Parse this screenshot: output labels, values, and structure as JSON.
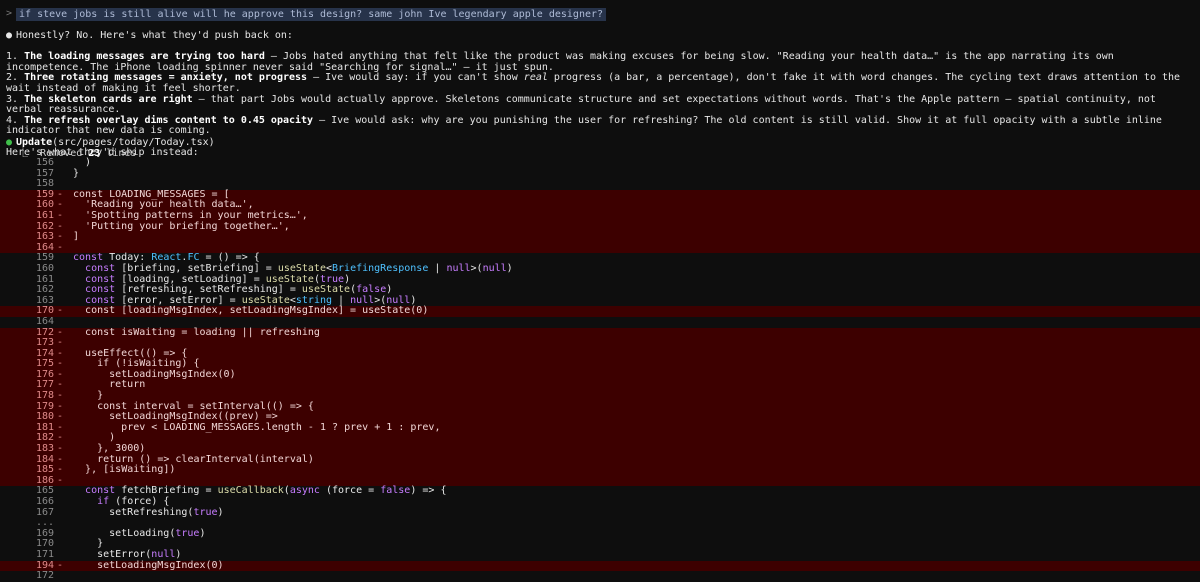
{
  "prompt": {
    "caret": ">",
    "text": "if steve jobs is still alive will he approve this design? same john Ive legendary apple designer?"
  },
  "response": {
    "intro": "Honestly? No. Here's what they'd push back on:",
    "items": [
      {
        "num": "1.",
        "title": "The loading messages are trying too hard",
        "body": " — Jobs hated anything that felt like the product was making excuses for being slow. \"Reading your health data…\" is the app narrating its own incompetence. The iPhone loading spinner never said \"Searching for signal…\" — it just spun."
      },
      {
        "num": "2.",
        "title": "Three rotating messages = anxiety, not progress",
        "body": " — Ive would say: if you can't show ",
        "em": "real",
        "body2": " progress (a bar, a percentage), don't fake it with word changes. The cycling text draws attention to the wait instead of making it feel shorter."
      },
      {
        "num": "3.",
        "title": "The skeleton cards are right",
        "body": " — that part Jobs would actually approve. Skeletons communicate structure and set expectations without words. That's the Apple pattern — spatial continuity, not verbal reassurance."
      },
      {
        "num": "4.",
        "title": "The refresh overlay dims content to 0.45 opacity",
        "body": " — Ive would ask: why are you punishing the user for refreshing? The old content is still valid. Show it at full opacity with a subtle inline indicator that new data is coming."
      }
    ],
    "outro": "Here's what they'd ship instead:"
  },
  "tool": {
    "name": "Update",
    "path": "(src/pages/today/Today.tsx)",
    "sub_prefix": "⎿  Removed ",
    "removed": "23",
    "sub_suffix": " lines"
  },
  "diff": [
    {
      "n": "156",
      "m": "",
      "t": "  )",
      "d": false
    },
    {
      "n": "157",
      "m": "",
      "t": "}",
      "d": false
    },
    {
      "n": "158",
      "m": "",
      "t": "",
      "d": false
    },
    {
      "n": "159",
      "m": "-",
      "t": "const LOADING_MESSAGES = [",
      "d": true
    },
    {
      "n": "160",
      "m": "-",
      "t": "  'Reading your health data…',",
      "d": true
    },
    {
      "n": "161",
      "m": "-",
      "t": "  'Spotting patterns in your metrics…',",
      "d": true
    },
    {
      "n": "162",
      "m": "-",
      "t": "  'Putting your briefing together…',",
      "d": true
    },
    {
      "n": "163",
      "m": "-",
      "t": "]",
      "d": true
    },
    {
      "n": "164",
      "m": "-",
      "t": "",
      "d": true
    },
    {
      "n": "159",
      "m": "",
      "t": "const Today: React.FC = () => {",
      "d": false
    },
    {
      "n": "160",
      "m": "",
      "t": "  const [briefing, setBriefing] = useState<BriefingResponse | null>(null)",
      "d": false
    },
    {
      "n": "161",
      "m": "",
      "t": "  const [loading, setLoading] = useState(true)",
      "d": false
    },
    {
      "n": "162",
      "m": "",
      "t": "  const [refreshing, setRefreshing] = useState(false)",
      "d": false
    },
    {
      "n": "163",
      "m": "",
      "t": "  const [error, setError] = useState<string | null>(null)",
      "d": false
    },
    {
      "n": "170",
      "m": "-",
      "t": "  const [loadingMsgIndex, setLoadingMsgIndex] = useState(0)",
      "d": true
    },
    {
      "n": "164",
      "m": "",
      "t": "",
      "d": false
    },
    {
      "n": "172",
      "m": "-",
      "t": "  const isWaiting = loading || refreshing",
      "d": true
    },
    {
      "n": "173",
      "m": "-",
      "t": "",
      "d": true
    },
    {
      "n": "174",
      "m": "-",
      "t": "  useEffect(() => {",
      "d": true
    },
    {
      "n": "175",
      "m": "-",
      "t": "    if (!isWaiting) {",
      "d": true
    },
    {
      "n": "176",
      "m": "-",
      "t": "      setLoadingMsgIndex(0)",
      "d": true
    },
    {
      "n": "177",
      "m": "-",
      "t": "      return",
      "d": true
    },
    {
      "n": "178",
      "m": "-",
      "t": "    }",
      "d": true
    },
    {
      "n": "179",
      "m": "-",
      "t": "    const interval = setInterval(() => {",
      "d": true
    },
    {
      "n": "180",
      "m": "-",
      "t": "      setLoadingMsgIndex((prev) =>",
      "d": true
    },
    {
      "n": "181",
      "m": "-",
      "t": "        prev < LOADING_MESSAGES.length - 1 ? prev + 1 : prev,",
      "d": true
    },
    {
      "n": "182",
      "m": "-",
      "t": "      )",
      "d": true
    },
    {
      "n": "183",
      "m": "-",
      "t": "    }, 3000)",
      "d": true
    },
    {
      "n": "184",
      "m": "-",
      "t": "    return () => clearInterval(interval)",
      "d": true
    },
    {
      "n": "185",
      "m": "-",
      "t": "  }, [isWaiting])",
      "d": true
    },
    {
      "n": "186",
      "m": "-",
      "t": "",
      "d": true
    },
    {
      "n": "165",
      "m": "",
      "t": "  const fetchBriefing = useCallback(async (force = false) => {",
      "d": false
    },
    {
      "n": "166",
      "m": "",
      "t": "    if (force) {",
      "d": false
    },
    {
      "n": "167",
      "m": "",
      "t": "      setRefreshing(true)",
      "d": false
    },
    {
      "n": "...",
      "m": "",
      "t": "",
      "d": false
    },
    {
      "n": "169",
      "m": "",
      "t": "      setLoading(true)",
      "d": false
    },
    {
      "n": "170",
      "m": "",
      "t": "    }",
      "d": false
    },
    {
      "n": "171",
      "m": "",
      "t": "    setError(null)",
      "d": false
    },
    {
      "n": "194",
      "m": "-",
      "t": "    setLoadingMsgIndex(0)",
      "d": true
    },
    {
      "n": "172",
      "m": "",
      "t": "",
      "d": false
    }
  ]
}
